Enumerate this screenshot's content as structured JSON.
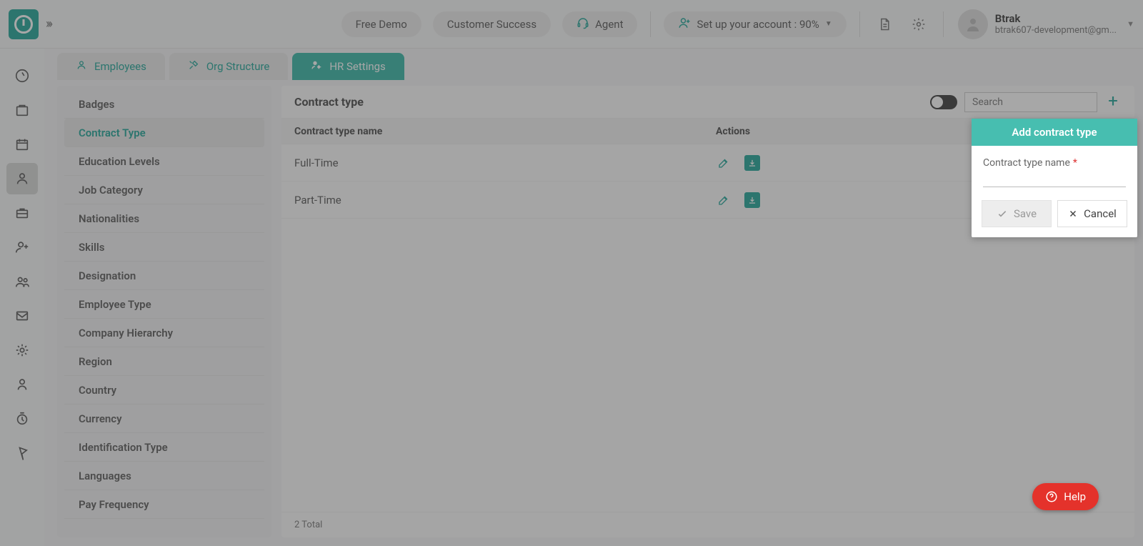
{
  "header": {
    "free_demo": "Free Demo",
    "customer_success": "Customer Success",
    "agent": "Agent",
    "setup_label": "Set up your account : 90%",
    "account_name": "Btrak",
    "account_email": "btrak607-development@gm..."
  },
  "tabs": {
    "employees": "Employees",
    "org_structure": "Org Structure",
    "hr_settings": "HR Settings"
  },
  "sidebar": {
    "items": [
      "Badges",
      "Contract Type",
      "Education Levels",
      "Job Category",
      "Nationalities",
      "Skills",
      "Designation",
      "Employee Type",
      "Company Hierarchy",
      "Region",
      "Country",
      "Currency",
      "Identification Type",
      "Languages",
      "Pay Frequency"
    ],
    "active_index": 1
  },
  "main": {
    "title": "Contract type",
    "search_placeholder": "Search",
    "columns": {
      "name": "Contract type name",
      "actions": "Actions"
    },
    "rows": [
      "Full-Time",
      "Part-Time"
    ],
    "footer": "2 Total"
  },
  "popover": {
    "title": "Add contract type",
    "field_label": "Contract type name",
    "required_marker": "*",
    "save": "Save",
    "cancel": "Cancel"
  },
  "help": {
    "label": "Help"
  }
}
